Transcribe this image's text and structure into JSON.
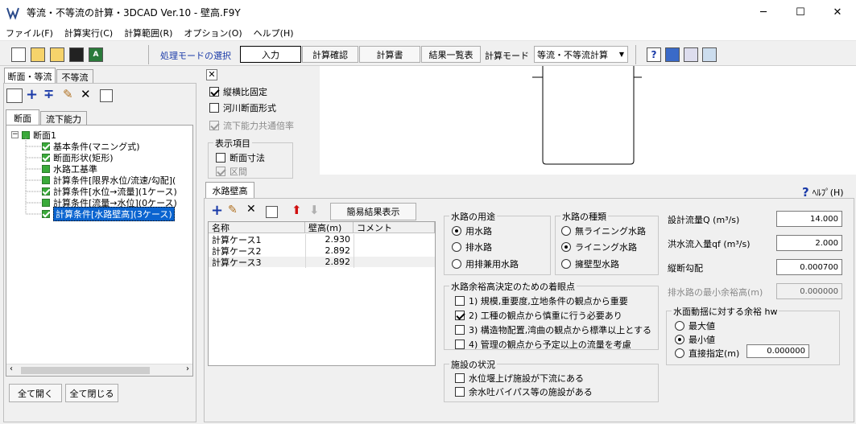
{
  "window": {
    "title": "等流・不等流の計算・3DCAD Ver.10 - 壁高.F9Y",
    "min": "─",
    "max": "☐",
    "close": "✕"
  },
  "menu": [
    "ファイル(F)",
    "計算実行(C)",
    "計算範囲(R)",
    "オプション(O)",
    "ヘルプ(H)"
  ],
  "toolbar": {
    "mode_select_label": "処理モードの選択",
    "input": "入力",
    "check": "計算確認",
    "report": "計算書",
    "result_list": "結果一覧表",
    "calc_mode_label": "計算モード",
    "calc_mode_value": "等流・不等流計算"
  },
  "left_tabs": {
    "tab1": "断面・等流",
    "tab2": "不等流"
  },
  "sub_tabs": {
    "tab1": "断面",
    "tab2": "流下能力"
  },
  "tree": {
    "root": "断面1",
    "items": [
      "基本条件(マニング式)",
      "断面形状(矩形)",
      "水路工基準",
      "計算条件[限界水位/流速/勾配](",
      "計算条件[水位→流量](1ケース)",
      "計算条件[流量→水位](0ケース)",
      "計算条件[水路壁高](3ケース)"
    ]
  },
  "left_buttons": {
    "expand": "全て開く",
    "collapse": "全て閉じる"
  },
  "view_options": {
    "aspect": "縦横比固定",
    "river": "河川断面形式",
    "common_rate": "流下能力共通倍率",
    "display_group": "表示項目",
    "section_dims": "断面寸法",
    "interval": "区間"
  },
  "bottom": {
    "tab": "水路壁高",
    "help": "ﾍﾙﾌﾟ(H)",
    "simple_result": "簡易結果表示",
    "grid_headers": [
      "名称",
      "壁高(m)",
      "コメント"
    ],
    "grid_rows": [
      {
        "name": "計算ケース1",
        "value": "2.930"
      },
      {
        "name": "計算ケース2",
        "value": "2.892"
      },
      {
        "name": "計算ケース3",
        "value": "2.892"
      }
    ]
  },
  "usage": {
    "title": "水路の用途",
    "opt1": "用水路",
    "opt2": "排水路",
    "opt3": "用排兼用水路"
  },
  "kind": {
    "title": "水路の種類",
    "opt1": "無ライニング水路",
    "opt2": "ライニング水路",
    "opt3": "擁壁型水路"
  },
  "margin": {
    "title": "水路余裕高決定のための着眼点",
    "c1": "1) 規模,重要度,立地条件の観点から重要",
    "c2": "2) 工種の観点から慎重に行う必要あり",
    "c3": "3) 構造物配置,湾曲の観点から標準以上とする",
    "c4": "4) 管理の観点から予定以上の流量を考慮"
  },
  "facility": {
    "title": "施設の状況",
    "c1": "水位堰上げ施設が下流にある",
    "c2": "余水吐バイパス等の施設がある"
  },
  "params": {
    "design_flow_label": "設計流量Q (m³/s)",
    "design_flow": "14.000",
    "flood_label": "洪水流入量qf (m³/s)",
    "flood": "2.000",
    "slope_label": "縦断勾配",
    "slope": "0.000700",
    "drain_label": "排水路の最小余裕高(m)",
    "drain": "0.000000"
  },
  "wave": {
    "title": "水面動揺に対する余裕 hw",
    "opt1": "最大値",
    "opt2": "最小値",
    "opt3": "直接指定(m)",
    "direct": "0.000000"
  }
}
